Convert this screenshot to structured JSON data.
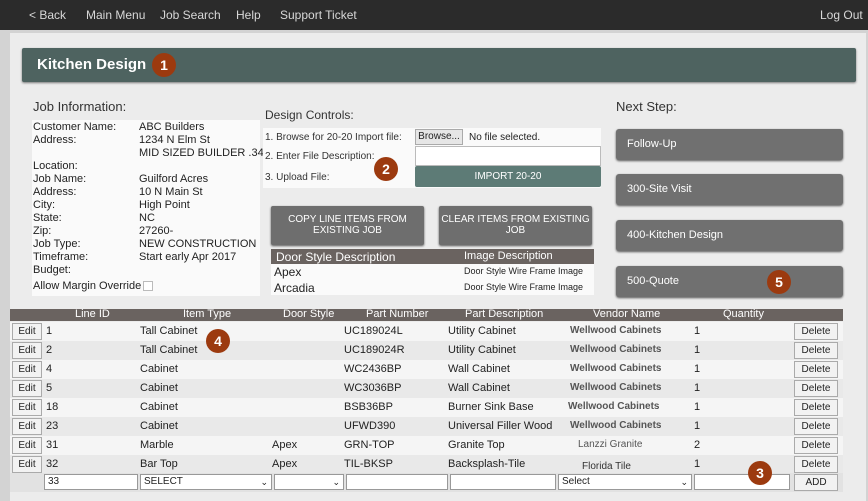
{
  "nav": {
    "back": "< Back",
    "main_menu": "Main Menu",
    "job_search": "Job Search",
    "help": "Help",
    "support": "Support Ticket",
    "logout": "Log Out"
  },
  "page_title": "Kitchen Design",
  "badges": [
    "1",
    "2",
    "3",
    "4",
    "5"
  ],
  "job_info": {
    "title": "Job Information:",
    "rows": [
      {
        "label": "Customer Name:",
        "value": "ABC Builders"
      },
      {
        "label": "Address:",
        "value": "1234 N Elm St"
      },
      {
        "label": "",
        "value": "MID SIZED BUILDER .34"
      },
      {
        "label": "Location:",
        "value": ""
      },
      {
        "label": "Job Name:",
        "value": "Guilford Acres"
      },
      {
        "label": "Address:",
        "value": "10 N Main St"
      },
      {
        "label": "City:",
        "value": "High Point"
      },
      {
        "label": "State:",
        "value": "NC"
      },
      {
        "label": "Zip:",
        "value": "27260-"
      },
      {
        "label": "Job Type:",
        "value": "NEW CONSTRUCTION"
      },
      {
        "label": "Timeframe:",
        "value": "Start early Apr 2017"
      },
      {
        "label": "Budget:",
        "value": ""
      }
    ],
    "margin_override": "Allow Margin Override"
  },
  "design_controls": {
    "title": "Design Controls:",
    "step1": "1. Browse for 20-20 Import file:",
    "browse": "Browse...",
    "no_file": "No file selected.",
    "step2": "2. Enter File Description:",
    "step3": "3. Upload File:",
    "import": "IMPORT 20-20",
    "copy_line1": "COPY LINE ITEMS FROM",
    "copy_line2": "EXISTING JOB",
    "clear_line1": "CLEAR ITEMS FROM EXISTING",
    "clear_line2": "JOB"
  },
  "door_styles": {
    "header_desc": "Door Style Description",
    "header_img": "Image Description",
    "rows": [
      {
        "name": "Apex",
        "image": "Door Style Wire Frame Image"
      },
      {
        "name": "Arcadia",
        "image": "Door Style Wire Frame Image"
      }
    ]
  },
  "next_step": {
    "title": "Next Step:",
    "buttons": [
      "Follow-Up",
      "300-Site Visit",
      "400-Kitchen Design",
      "500-Quote"
    ]
  },
  "grid": {
    "headers": [
      "Line ID",
      "Item Type",
      "Door Style",
      "Part Number",
      "Part Description",
      "Vendor Name",
      "Quantity"
    ],
    "edit": "Edit",
    "delete": "Delete",
    "add": "ADD",
    "rows": [
      {
        "id": "1",
        "type": "Tall Cabinet",
        "door": "",
        "part": "UC189024L",
        "desc": "Utility Cabinet",
        "vendor": "Wellwood Cabinets",
        "qty": "1"
      },
      {
        "id": "2",
        "type": "Tall Cabinet",
        "door": "",
        "part": "UC189024R",
        "desc": "Utility Cabinet",
        "vendor": "Wellwood Cabinets",
        "qty": "1"
      },
      {
        "id": "4",
        "type": "Cabinet",
        "door": "",
        "part": "WC2436BP",
        "desc": "Wall Cabinet",
        "vendor": "Wellwood Cabinets",
        "qty": "1"
      },
      {
        "id": "5",
        "type": "Cabinet",
        "door": "",
        "part": "WC3036BP",
        "desc": "Wall Cabinet",
        "vendor": "Wellwood Cabinets",
        "qty": "1"
      },
      {
        "id": "18",
        "type": "Cabinet",
        "door": "",
        "part": "BSB36BP",
        "desc": "Burner Sink Base",
        "vendor": "Wellwood Cabinets",
        "qty": "1"
      },
      {
        "id": "23",
        "type": "Cabinet",
        "door": "",
        "part": "UFWD390",
        "desc": "Universal Filler Wood",
        "vendor": "Wellwood Cabinets",
        "qty": "1"
      },
      {
        "id": "31",
        "type": "Marble",
        "door": "Apex",
        "part": "GRN-TOP",
        "desc": "Granite Top",
        "vendor": "Lanzzi Granite",
        "qty": "2"
      },
      {
        "id": "32",
        "type": "Bar Top",
        "door": "Apex",
        "part": "TIL-BKSP",
        "desc": "Backsplash-Tile",
        "vendor": "Florida Tile",
        "qty": "1"
      }
    ],
    "new_row": {
      "id": "33",
      "type_select": "SELECT",
      "vendor_select": "Select"
    }
  }
}
